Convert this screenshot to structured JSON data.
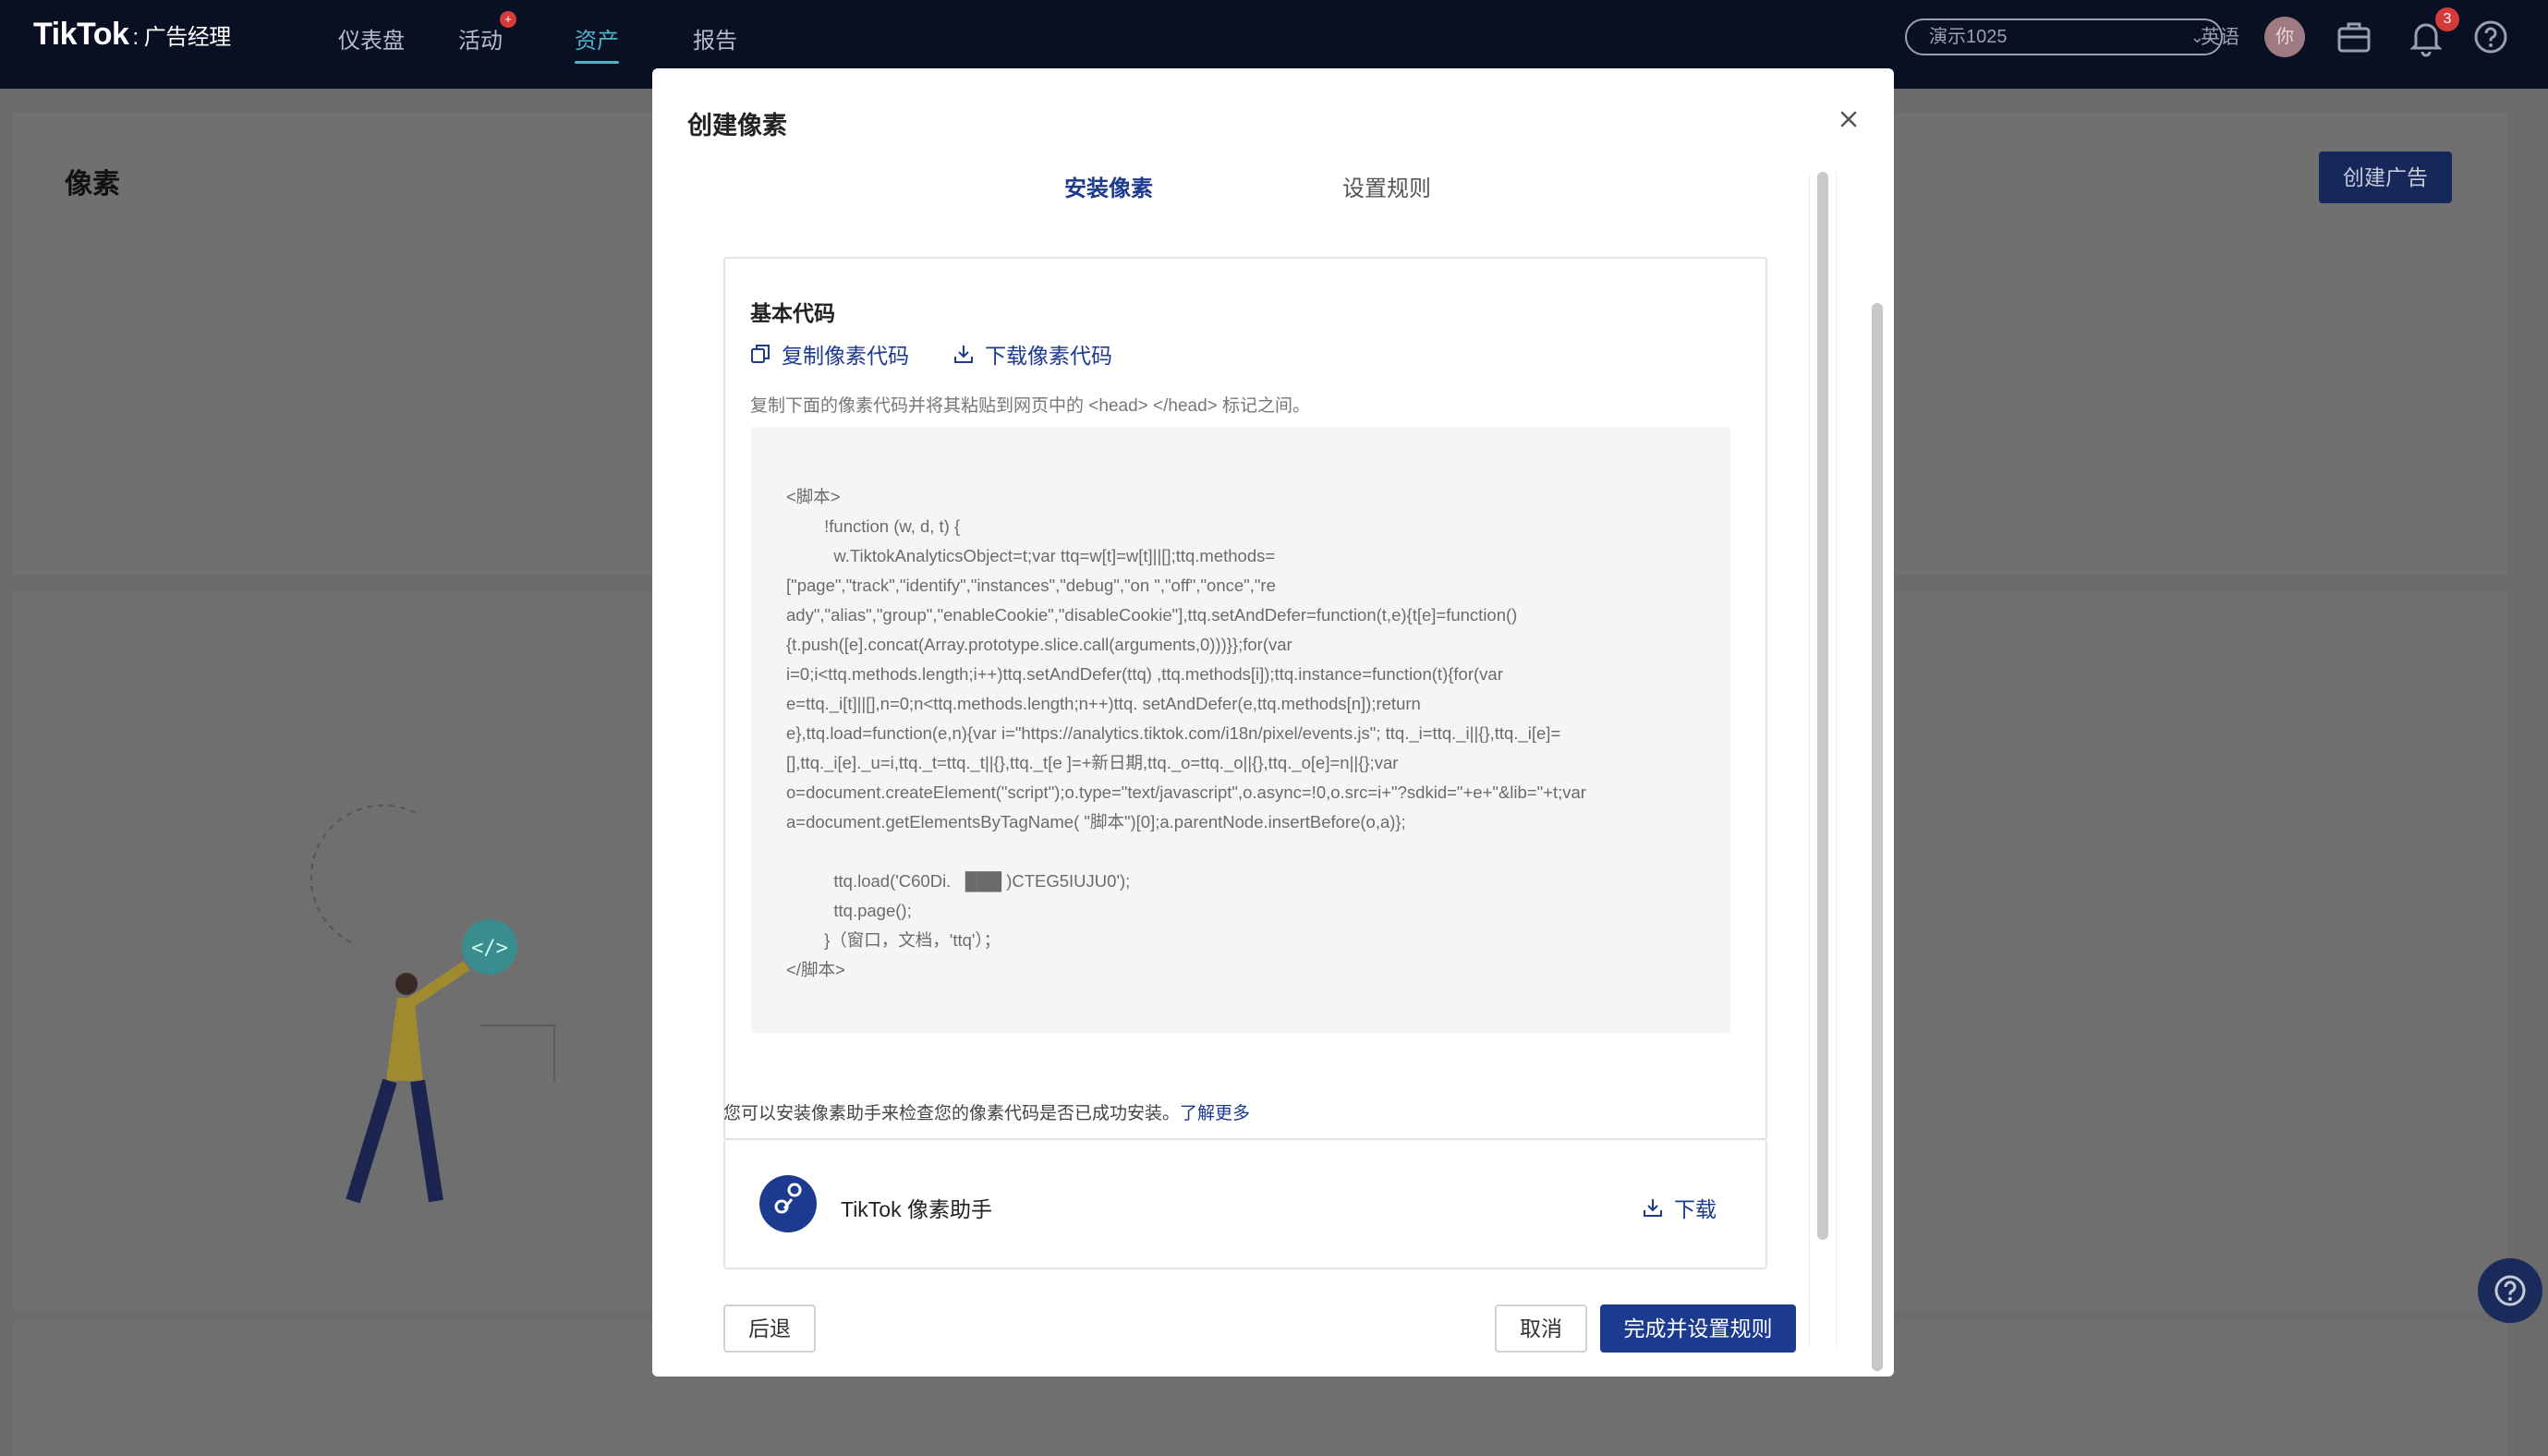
{
  "header": {
    "logo": "TikTok",
    "logo_sub": ": 广告经理",
    "nav": [
      "仪表盘",
      "活动",
      "资产",
      "报告"
    ],
    "nav_active": "资产",
    "account": "演示1025",
    "language": "英语",
    "avatar_text": "你",
    "notification_count": "3"
  },
  "page": {
    "title": "像素",
    "create_ad_button": "创建广告"
  },
  "modal": {
    "title": "创建像素",
    "tabs": [
      "安装像素",
      "设置规则"
    ],
    "active_tab": "安装像素",
    "base_code": {
      "title": "基本代码",
      "copy_link": "复制像素代码",
      "download_link": "下载像素代码",
      "instruction": "复制下面的像素代码并将其粘贴到网页中的 <head> </head> 标记之间。",
      "code_lines": [
        "<脚本>",
        "        !function (w, d, t) {",
        "          w.TiktokAnalyticsObject=t;var ttq=w[t]=w[t]||[];ttq.methods=",
        "[\"page\",\"track\",\"identify\",\"instances\",\"debug\",\"on \",\"off\",\"once\",\"re",
        "ady\",\"alias\",\"group\",\"enableCookie\",\"disableCookie\"],ttq.setAndDefer=function(t,e){t[e]=function()",
        "{t.push([e].concat(Array.prototype.slice.call(arguments,0)))}};for(var",
        "i=0;i<ttq.methods.length;i++)ttq.setAndDefer(ttq) ,ttq.methods[i]);ttq.instance=function(t){for(var",
        "e=ttq._i[t]||[],n=0;n<ttq.methods.length;n++)ttq. setAndDefer(e,ttq.methods[n]);return",
        "e},ttq.load=function(e,n){var i=\"https://analytics.tiktok.com/i18n/pixel/events.js\"; ttq._i=ttq._i||{},ttq._i[e]=",
        "[],ttq._i[e]._u=i,ttq._t=ttq._t||{},ttq._t[e ]=+新日期,ttq._o=ttq._o||{},ttq._o[e]=n||{};var",
        "o=document.createElement(\"script\");o.type=\"text/javascript\",o.async=!0,o.src=i+\"?sdkid=\"+e+\"&lib=\"+t;var",
        "a=document.getElementsByTagName( \"脚本\")[0];a.parentNode.insertBefore(o,a)};",
        "",
        "          ttq.load('C60Di.   ███ )CTEG5IUJU0');",
        "          ttq.page();",
        "        }（窗口，文档，'ttq'）；",
        "</脚本>"
      ]
    },
    "assistant_hint": "您可以安装像素助手来检查您的像素代码是否已成功安装。",
    "learn_more": "了解更多",
    "assistant_name": "TikTok 像素助手",
    "assistant_download": "下载",
    "buttons": {
      "back": "后退",
      "cancel": "取消",
      "finish": "完成并设置规则"
    }
  }
}
